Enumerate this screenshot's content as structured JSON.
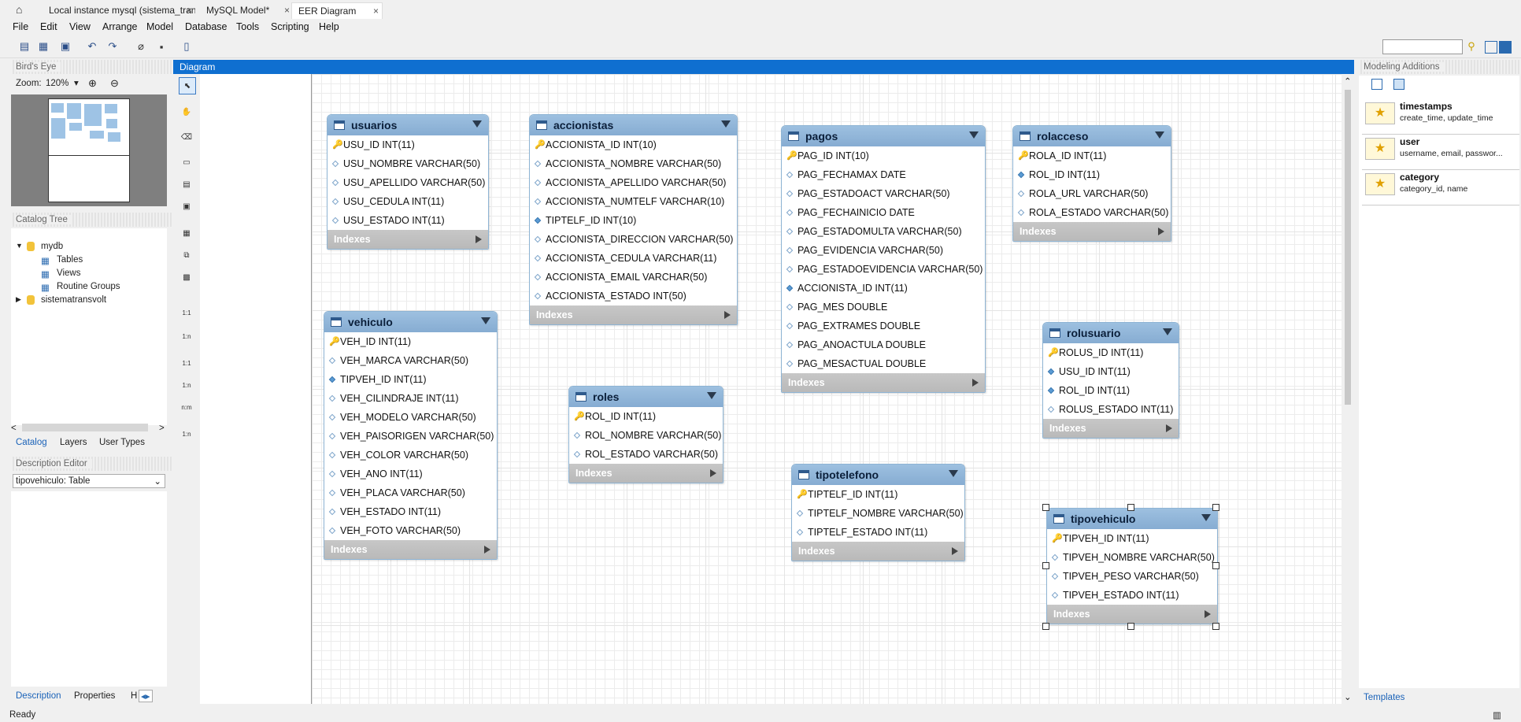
{
  "tabs": [
    {
      "label": "Local instance mysql (sistema_tran...",
      "close": "×"
    },
    {
      "label": "MySQL Model*",
      "close": "×"
    },
    {
      "label": "EER Diagram",
      "close": "×"
    }
  ],
  "menu": [
    "File",
    "Edit",
    "View",
    "Arrange",
    "Model",
    "Database",
    "Tools",
    "Scripting",
    "Help"
  ],
  "birds_eye": {
    "title": "Bird's Eye",
    "zoom_label": "Zoom:",
    "zoom_value": "120%"
  },
  "catalog_tree": {
    "title": "Catalog Tree",
    "schema1": "mydb",
    "children": [
      "Tables",
      "Views",
      "Routine Groups"
    ],
    "schema2": "sistematransvolt"
  },
  "left_tabs": [
    "Catalog",
    "Layers",
    "User Types"
  ],
  "description_editor": {
    "title": "Description Editor",
    "selected": "tipovehiculo: Table"
  },
  "bottom_tabs": [
    "Description",
    "Properties",
    "H"
  ],
  "diagram_title": "Diagram",
  "palette_rel": [
    "1:1",
    "1:n",
    "1:1",
    "1:n",
    "n:m",
    "1:n"
  ],
  "tables": {
    "usuarios": {
      "name": "usuarios",
      "columns": [
        "USU_ID INT(11)",
        "USU_NOMBRE VARCHAR(50)",
        "USU_APELLIDO VARCHAR(50)",
        "USU_CEDULA INT(11)",
        "USU_ESTADO INT(11)"
      ]
    },
    "accionistas": {
      "name": "accionistas",
      "columns": [
        "ACCIONISTA_ID INT(10)",
        "ACCIONISTA_NOMBRE VARCHAR(50)",
        "ACCIONISTA_APELLIDO VARCHAR(50)",
        "ACCIONISTA_NUMTELF VARCHAR(10)",
        "TIPTELF_ID INT(10)",
        "ACCIONISTA_DIRECCION VARCHAR(50)",
        "ACCIONISTA_CEDULA VARCHAR(11)",
        "ACCIONISTA_EMAIL VARCHAR(50)",
        "ACCIONISTA_ESTADO INT(50)"
      ]
    },
    "pagos": {
      "name": "pagos",
      "columns": [
        "PAG_ID INT(10)",
        "PAG_FECHAMAX DATE",
        "PAG_ESTADOACT VARCHAR(50)",
        "PAG_FECHAINICIO DATE",
        "PAG_ESTADOMULTA VARCHAR(50)",
        "PAG_EVIDENCIA VARCHAR(50)",
        "PAG_ESTADOEVIDENCIA VARCHAR(50)",
        "ACCIONISTA_ID INT(11)",
        "PAG_MES DOUBLE",
        "PAG_EXTRAMES DOUBLE",
        "PAG_ANOACTULA DOUBLE",
        "PAG_MESACTUAL DOUBLE"
      ]
    },
    "rolacceso": {
      "name": "rolacceso",
      "columns": [
        "ROLA_ID INT(11)",
        "ROL_ID INT(11)",
        "ROLA_URL VARCHAR(50)",
        "ROLA_ESTADO VARCHAR(50)"
      ]
    },
    "vehiculo": {
      "name": "vehiculo",
      "columns": [
        "VEH_ID INT(11)",
        "VEH_MARCA VARCHAR(50)",
        "TIPVEH_ID INT(11)",
        "VEH_CILINDRAJE INT(11)",
        "VEH_MODELO VARCHAR(50)",
        "VEH_PAISORIGEN VARCHAR(50)",
        "VEH_COLOR VARCHAR(50)",
        "VEH_ANO INT(11)",
        "VEH_PLACA VARCHAR(50)",
        "VEH_ESTADO INT(11)",
        "VEH_FOTO VARCHAR(50)"
      ]
    },
    "roles": {
      "name": "roles",
      "columns": [
        "ROL_ID INT(11)",
        "ROL_NOMBRE VARCHAR(50)",
        "ROL_ESTADO VARCHAR(50)"
      ]
    },
    "rolusuario": {
      "name": "rolusuario",
      "columns": [
        "ROLUS_ID INT(11)",
        "USU_ID INT(11)",
        "ROL_ID INT(11)",
        "ROLUS_ESTADO INT(11)"
      ]
    },
    "tipotelefono": {
      "name": "tipotelefono",
      "columns": [
        "TIPTELF_ID INT(11)",
        "TIPTELF_NOMBRE VARCHAR(50)",
        "TIPTELF_ESTADO INT(11)"
      ]
    },
    "tipovehiculo": {
      "name": "tipovehiculo",
      "columns": [
        "TIPVEH_ID INT(11)",
        "TIPVEH_NOMBRE VARCHAR(50)",
        "TIPVEH_PESO VARCHAR(50)",
        "TIPVEH_ESTADO INT(11)"
      ]
    }
  },
  "indexes_label": "Indexes",
  "modeling_additions": {
    "title": "Modeling Additions",
    "templates": [
      {
        "title": "timestamps",
        "desc": "create_time, update_time"
      },
      {
        "title": "user",
        "desc": "username, email, passwor..."
      },
      {
        "title": "category",
        "desc": "category_id, name"
      }
    ],
    "tab": "Templates"
  },
  "status": "Ready"
}
